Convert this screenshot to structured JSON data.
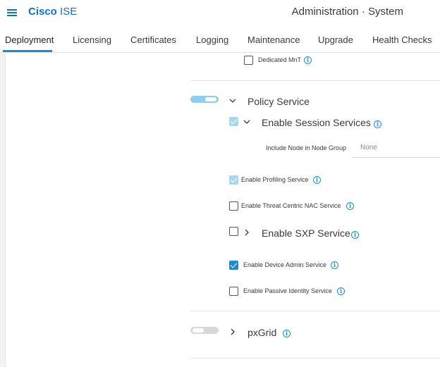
{
  "header": {
    "brand_bold": "Cisco",
    "brand_light": "ISE",
    "context": "Administration · System",
    "menu_icon": "hamburger-menu-icon"
  },
  "tabs": [
    {
      "label": "Deployment",
      "active": true
    },
    {
      "label": "Licensing"
    },
    {
      "label": "Certificates"
    },
    {
      "label": "Logging"
    },
    {
      "label": "Maintenance"
    },
    {
      "label": "Upgrade"
    },
    {
      "label": "Health Checks"
    }
  ],
  "dedicated_mnt": {
    "label": "Dedicated MnT",
    "checked": false
  },
  "policy_service": {
    "label": "Policy Service",
    "toggle_on": true,
    "expanded": true
  },
  "session_services": {
    "label": "Enable Session Services",
    "checked": true,
    "expanded": true,
    "node_group_label": "Include Node in Node Group",
    "node_group_value": "None"
  },
  "profiling": {
    "label": "Enable Profiling Service",
    "checked": true
  },
  "threat_centric": {
    "label": "Enable Threat Centric NAC Service",
    "checked": false
  },
  "sxp": {
    "label": "Enable SXP Service",
    "checked": false,
    "expanded": false
  },
  "device_admin": {
    "label": "Enable Device Admin Service",
    "checked": true
  },
  "passive_identity": {
    "label": "Enable Passive Identity Service",
    "checked": false
  },
  "pxgrid": {
    "label": "pxGrid",
    "toggle_on": false,
    "expanded": false
  },
  "colors": {
    "accent": "#1a8bd8",
    "brand": "#1170cf"
  }
}
